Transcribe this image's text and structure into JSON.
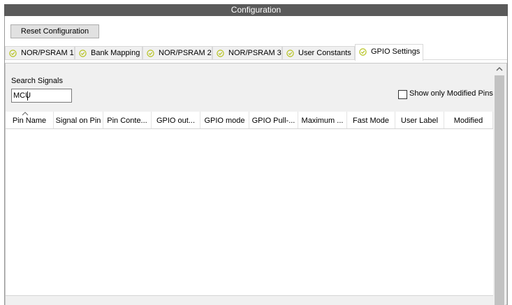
{
  "window": {
    "title": "Configuration"
  },
  "toolbar": {
    "reset_label": "Reset Configuration"
  },
  "tabs": [
    {
      "label": "NOR/PSRAM 1",
      "icon": "check-circle-icon",
      "active": false
    },
    {
      "label": "Bank Mapping",
      "icon": "check-circle-icon",
      "active": false
    },
    {
      "label": "NOR/PSRAM 2",
      "icon": "check-circle-icon",
      "active": false
    },
    {
      "label": "NOR/PSRAM 3",
      "icon": "check-circle-icon",
      "active": false
    },
    {
      "label": "User Constants",
      "icon": "check-circle-icon",
      "active": false
    },
    {
      "label": "GPIO Settings",
      "icon": "check-circle-icon",
      "active": true
    }
  ],
  "search": {
    "label": "Search Signals",
    "value": "MCU"
  },
  "filter": {
    "show_modified_label": "Show only Modified Pins",
    "checked": false
  },
  "table": {
    "columns": [
      "Pin Name",
      "Signal on Pin",
      "Pin Conte...",
      "GPIO out...",
      "GPIO mode",
      "GPIO Pull-...",
      "Maximum ...",
      "Fast Mode",
      "User Label",
      "Modified"
    ],
    "rows": []
  },
  "colors": {
    "title_bar": "#5a5a5a",
    "tab_icon": "#b5c21b"
  }
}
